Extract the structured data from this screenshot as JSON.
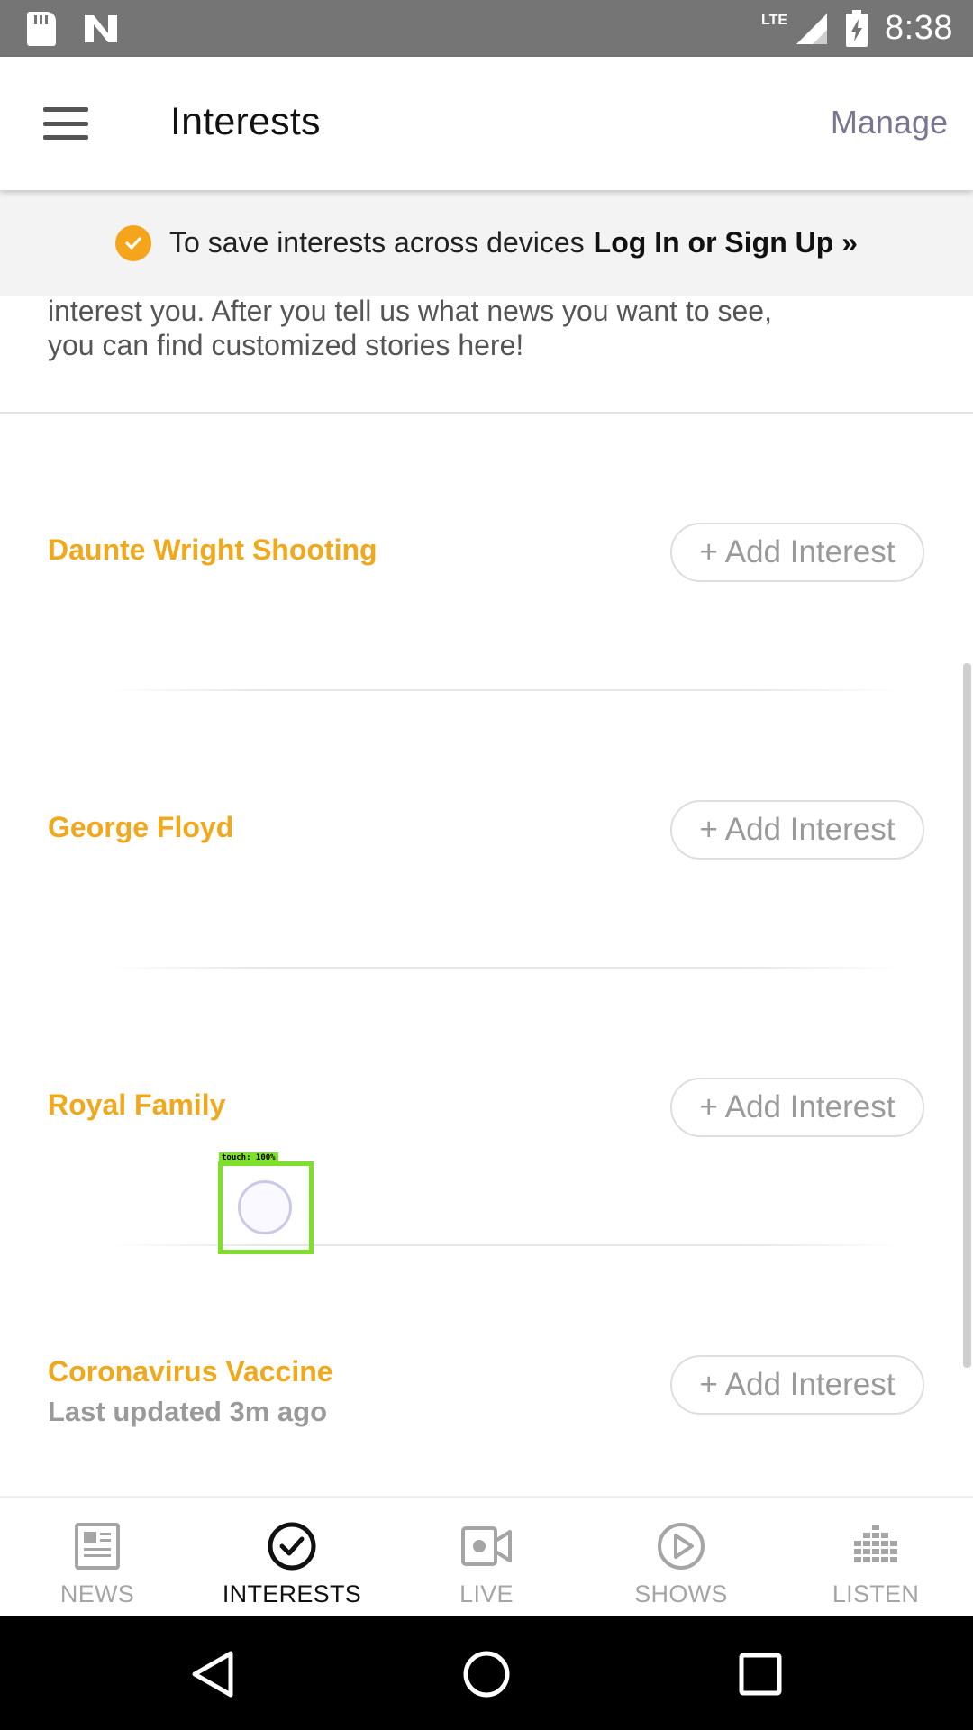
{
  "status_bar": {
    "time": "8:38",
    "network": "LTE",
    "icons": [
      "sd-card-icon",
      "n-app-icon",
      "signal-icon",
      "battery-charging-icon"
    ]
  },
  "app_bar": {
    "title": "Interests",
    "manage_label": "Manage"
  },
  "banner": {
    "text": "To save interests across devices",
    "link": "Log In or Sign Up »"
  },
  "intro": {
    "line_partial": "interest you. After you tell us what news you want to see,",
    "line_last": "you can find customized stories here!"
  },
  "topics": [
    {
      "name": "Daunte Wright Shooting",
      "meta": "",
      "button": "+ Add Interest"
    },
    {
      "name": "George Floyd",
      "meta": "",
      "button": "+ Add Interest"
    },
    {
      "name": "Royal Family",
      "meta": "",
      "button": "+ Add Interest"
    },
    {
      "name": "Coronavirus Vaccine",
      "meta": "Last updated 3m ago",
      "button": "+ Add Interest"
    }
  ],
  "touch_overlay": {
    "label": "touch: 100%"
  },
  "bottom_nav": {
    "items": [
      {
        "label": "NEWS",
        "icon": "newspaper-icon",
        "active": false
      },
      {
        "label": "INTERESTS",
        "icon": "check-circle-icon",
        "active": true
      },
      {
        "label": "LIVE",
        "icon": "video-camera-icon",
        "active": false
      },
      {
        "label": "SHOWS",
        "icon": "play-circle-icon",
        "active": false
      },
      {
        "label": "LISTEN",
        "icon": "equalizer-icon",
        "active": false
      }
    ]
  },
  "colors": {
    "accent": "#f0a81c",
    "status_bar": "#757575",
    "manage": "#7a7590"
  }
}
